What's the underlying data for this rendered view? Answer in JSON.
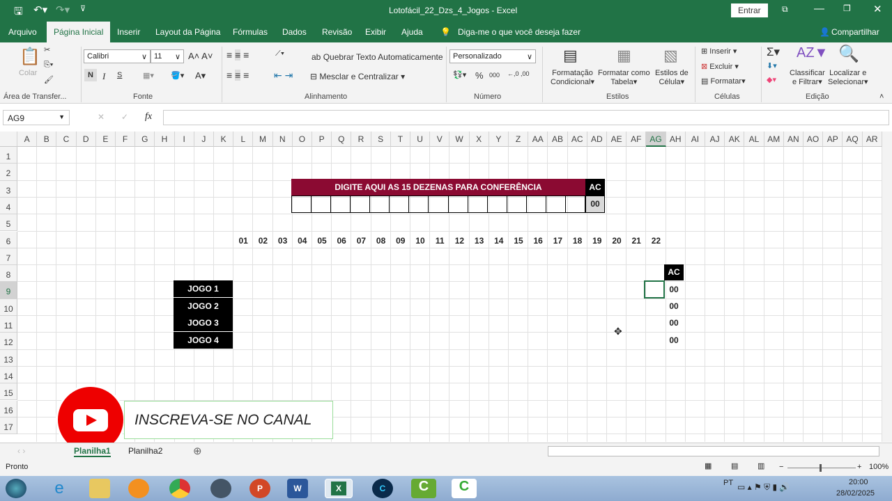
{
  "window": {
    "title": "Lotofácil_22_Dzs_4_Jogos  -  Excel",
    "signin": "Entrar"
  },
  "tabs": [
    "Arquivo",
    "Página Inicial",
    "Inserir",
    "Layout da Página",
    "Fórmulas",
    "Dados",
    "Revisão",
    "Exibir",
    "Ajuda"
  ],
  "tell_me": "Diga-me o que você deseja fazer",
  "share": "Compartilhar",
  "ribbon": {
    "paste": "Colar",
    "clipboard": "Área de Transfer...",
    "font_name": "Calibri",
    "font_size": "11",
    "bold": "N",
    "italic": "I",
    "underline": "S",
    "font_group": "Fonte",
    "wrap": "Quebrar Texto Automaticamente",
    "merge": "Mesclar e Centralizar",
    "align_group": "Alinhamento",
    "number_format": "Personalizado",
    "percent": "%",
    "thousands": "000",
    "number_group": "Número",
    "cond_format": [
      "Formatação",
      "Condicional"
    ],
    "format_table": [
      "Formatar como",
      "Tabela"
    ],
    "cell_styles": [
      "Estilos de",
      "Célula"
    ],
    "styles_group": "Estilos",
    "insert": "Inserir",
    "delete": "Excluir",
    "format": "Formatar",
    "cells_group": "Células",
    "sort": [
      "Classificar",
      "e Filtrar"
    ],
    "find": [
      "Localizar e",
      "Selecionar"
    ],
    "editing_group": "Edição"
  },
  "formula_bar": {
    "name_box": "AG9",
    "fx": "fx",
    "value": ""
  },
  "columns": [
    "A",
    "B",
    "C",
    "D",
    "E",
    "F",
    "G",
    "H",
    "I",
    "J",
    "K",
    "L",
    "M",
    "N",
    "O",
    "P",
    "Q",
    "R",
    "S",
    "T",
    "U",
    "V",
    "W",
    "X",
    "Y",
    "Z",
    "AA",
    "AB",
    "AC",
    "AD",
    "AE",
    "AF",
    "AG",
    "AH",
    "AI",
    "AJ",
    "AK",
    "AL",
    "AM",
    "AN",
    "AO",
    "AP",
    "AQ",
    "AR"
  ],
  "rows": [
    "1",
    "2",
    "3",
    "4",
    "5",
    "6",
    "7",
    "8",
    "9",
    "10",
    "11",
    "12",
    "13",
    "14",
    "15",
    "16",
    "17"
  ],
  "sheet": {
    "banner": "DIGITE AQUI AS 15 DEZENAS PARA CONFERÊNCIA",
    "banner_ac": "AC",
    "banner_ac_value": "00",
    "numbers": [
      "01",
      "02",
      "03",
      "04",
      "05",
      "06",
      "07",
      "08",
      "09",
      "10",
      "11",
      "12",
      "13",
      "14",
      "15",
      "16",
      "17",
      "18",
      "19",
      "20",
      "21",
      "22"
    ],
    "jogos": [
      "JOGO 1",
      "JOGO 2",
      "JOGO 3",
      "JOGO 4"
    ],
    "ac_header": "AC",
    "ac_values": [
      "00",
      "00",
      "00",
      "00"
    ],
    "banner_color": "#8b0a32"
  },
  "overlay": {
    "subscribe": "INSCREVA-SE NO CANAL"
  },
  "sheets": [
    "Planilha1",
    "Planilha2"
  ],
  "status": {
    "ready": "Pronto",
    "zoom": "100%"
  },
  "taskbar": {
    "lang": "PT",
    "time": "20:00",
    "date": "28/02/2025"
  }
}
